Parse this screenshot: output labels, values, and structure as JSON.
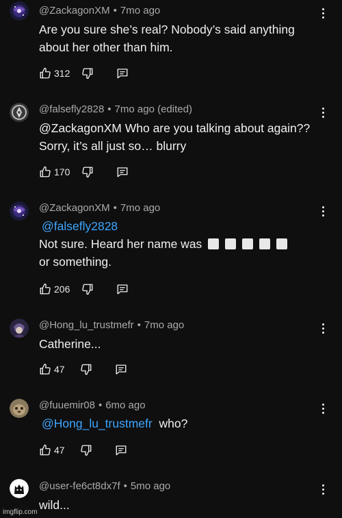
{
  "comments": [
    {
      "author": "@ZackagonXM",
      "time": "7mo ago",
      "edited": "",
      "mention": "",
      "text": "Are you sure she’s real? Nobody’s said anything about her other than him.",
      "text_after": "",
      "likes": "312",
      "avatar": "galaxy-avatar"
    },
    {
      "author": "@falsefly2828",
      "time": "7mo ago",
      "edited": "(edited)",
      "mention": "",
      "text": "@ZackagonXM Who are you talking about again?? Sorry, it’s all just so… blurry",
      "text_after": "",
      "likes": "170",
      "avatar": "emblem-avatar"
    },
    {
      "author": "@ZackagonXM",
      "time": "7mo ago",
      "edited": "",
      "mention": "@falsefly2828",
      "text": "Not sure. Heard her name was",
      "text_after": "or something.",
      "likes": "206",
      "avatar": "galaxy-avatar"
    },
    {
      "author": "@Hong_lu_trustmefr",
      "time": "7mo ago",
      "edited": "",
      "mention": "",
      "text": "Catherine...",
      "text_after": "",
      "likes": "47",
      "avatar": "character-avatar"
    },
    {
      "author": "@fuuemir08",
      "time": "6mo ago",
      "edited": "",
      "mention": "@Hong_lu_trustmefr",
      "text": "who?",
      "text_after": "",
      "likes": "47",
      "avatar": "photo-avatar"
    },
    {
      "author": "@user-fe6ct8dx7f",
      "time": "5mo ago",
      "edited": "",
      "mention": "",
      "text": "wild...",
      "text_after": "",
      "likes": "",
      "avatar": "cat-avatar"
    }
  ],
  "separator": "•",
  "watermark": "imgflip.com",
  "colors": {
    "background": "#0f0f0f",
    "text": "#f1f1f1",
    "meta": "#aaaaaa",
    "mention": "#3ea6ff"
  },
  "icons": [
    "thumbs-up-icon",
    "thumbs-down-icon",
    "reply-icon",
    "more-vert-icon"
  ]
}
